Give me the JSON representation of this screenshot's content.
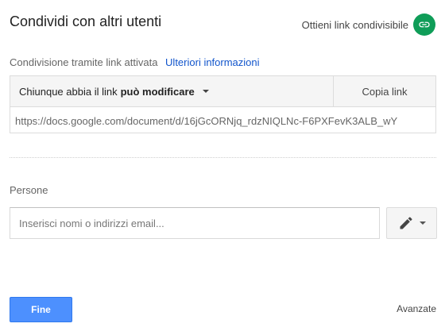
{
  "dialog": {
    "title": "Condividi con altri utenti",
    "get_link_label": "Ottieni link condivisibile",
    "link_toggle_icon": "link-icon",
    "link_toggle_color": "#0f9d58"
  },
  "link_sharing": {
    "status": "Condivisione tramite link attivata",
    "learn_more": "Ulteriori informazioni",
    "permission_prefix": "Chiunque abbia il link",
    "permission_value": "può modificare",
    "copy_label": "Copia link",
    "url": "https://docs.google.com/document/d/16jGcORNjq_rdzNIQLNc-F6PXFevK3ALB_wY"
  },
  "people": {
    "label": "Persone",
    "placeholder": "Inserisci nomi o indirizzi email...",
    "permission_icon": "pencil-icon"
  },
  "footer": {
    "done_label": "Fine",
    "advanced_label": "Avanzate",
    "done_color": "#4d90fe"
  }
}
